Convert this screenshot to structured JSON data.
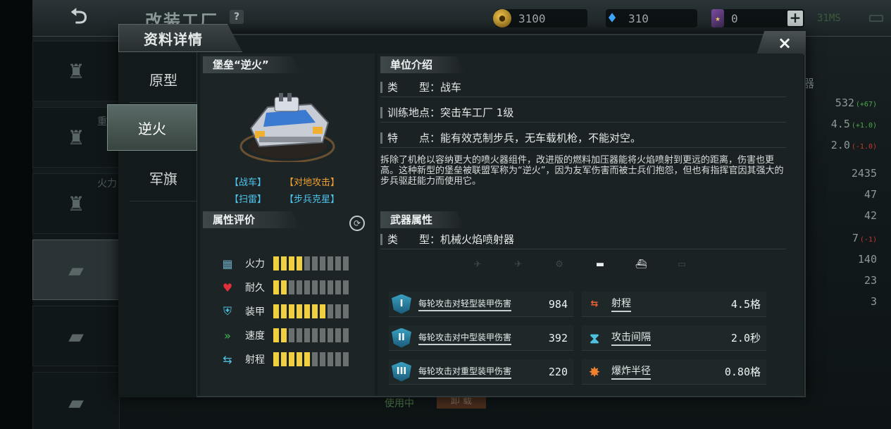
{
  "background": {
    "title": "改装工厂",
    "help": "?",
    "resources": {
      "gold": "3100",
      "gems": "310",
      "cards": "0"
    },
    "net_status": "31MS",
    "right_header": "器",
    "right_rows": [
      {
        "v": "532",
        "d": "(+67)",
        "dir": "up"
      },
      {
        "v": "4.5",
        "d": "(+1.0)",
        "dir": "up"
      },
      {
        "v": "2.0",
        "d": "(-1.0)",
        "dir": "down"
      },
      {
        "v": "2435",
        "d": "",
        "dir": ""
      },
      {
        "v": "47",
        "d": "",
        "dir": ""
      },
      {
        "v": "42",
        "d": "",
        "dir": ""
      },
      {
        "v": "7",
        "d": "(-1)",
        "dir": "down"
      },
      {
        "v": "140",
        "d": "",
        "dir": ""
      },
      {
        "v": "23",
        "d": "",
        "dir": ""
      },
      {
        "v": "3",
        "d": "",
        "dir": ""
      }
    ],
    "side_label_fire": "火力",
    "side_label_2": "重",
    "bottom_using": "使用中",
    "bottom_unload": "卸 载"
  },
  "modal": {
    "title": "资料详情",
    "close": "×",
    "tabs": [
      "原型",
      "逆火",
      "军旗"
    ],
    "active_tab": 1
  },
  "unit": {
    "header": "堡垒“逆火”",
    "tags": {
      "type": "【战车】",
      "role": "【对地攻击】",
      "skill": "【扫雷】",
      "counter": "【步兵克星】"
    }
  },
  "attributes": {
    "header": "属性评价",
    "rows": [
      {
        "label": "火力",
        "icon": "bricks-icon",
        "filled": 4,
        "total": 10
      },
      {
        "label": "耐久",
        "icon": "heart-icon",
        "filled": 2,
        "total": 10
      },
      {
        "label": "装甲",
        "icon": "armor-shield-icon",
        "filled": 7,
        "total": 10
      },
      {
        "label": "速度",
        "icon": "speed-chevron-icon",
        "filled": 2,
        "total": 10
      },
      {
        "label": "射程",
        "icon": "range-arrows-icon",
        "filled": 5,
        "total": 10
      }
    ]
  },
  "intro": {
    "header": "单位介绍",
    "type_label": "类　　型：",
    "type_value": "战车",
    "train_label": "训练地点：",
    "train_value": "突击车工厂 1级",
    "feature_label": "特　　点：",
    "feature_value": "能有效克制步兵，无车载机枪，不能对空。",
    "description": "拆除了机枪以容纳更大的喷火器组件，改进版的燃料加压器能将火焰喷射到更远的距离，伤害也更高。这种新型的堡垒被联盟军称为“逆火”，因为友军伤害而被士兵们抱怨，但也有指挥官因其强大的步兵驱赶能力而使用它。"
  },
  "weapon": {
    "header": "武器属性",
    "type_label": "类　　型：",
    "type_value": "机械火焰喷射器",
    "targets": [
      {
        "name": "fighter-jet-icon",
        "glyph": "✈",
        "on": false
      },
      {
        "name": "bomber-icon",
        "glyph": "✈",
        "on": false
      },
      {
        "name": "helicopter-icon",
        "glyph": "⚙",
        "on": false
      },
      {
        "name": "tank-icon",
        "glyph": "▬",
        "on": true
      },
      {
        "name": "ship-icon",
        "glyph": "⛴",
        "on": true
      },
      {
        "name": "submarine-icon",
        "glyph": "▭",
        "on": false
      }
    ],
    "stats_left": [
      {
        "label": "每轮攻击对轻型装甲伤害",
        "value": "984",
        "badge": "I"
      },
      {
        "label": "每轮攻击对中型装甲伤害",
        "value": "392",
        "badge": "II"
      },
      {
        "label": "每轮攻击对重型装甲伤害",
        "value": "220",
        "badge": "III"
      }
    ],
    "stats_right": [
      {
        "label": "射程",
        "value": "4.5格"
      },
      {
        "label": "攻击间隔",
        "value": "2.0秒"
      },
      {
        "label": "爆炸半径",
        "value": "0.80格"
      }
    ]
  }
}
